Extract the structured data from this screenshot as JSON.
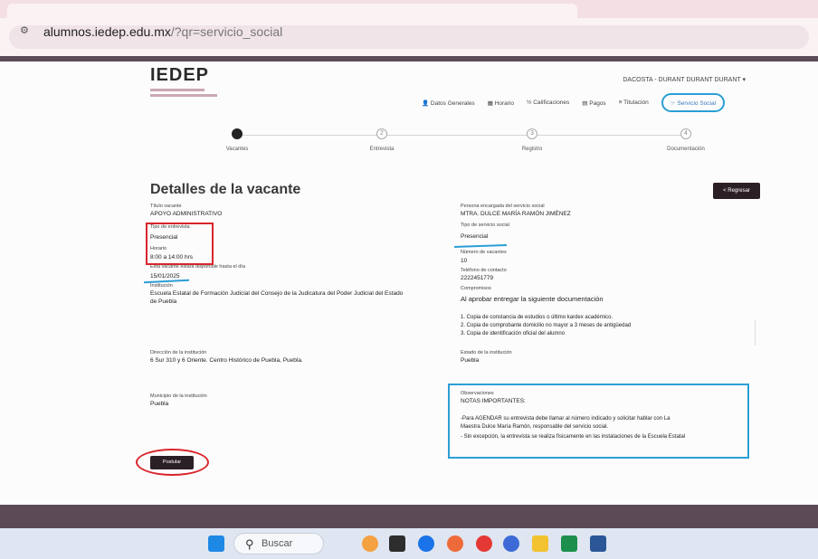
{
  "browser": {
    "url_host": "alumnos.iedep.edu.mx",
    "url_path": "/?qr=servicio_social",
    "site_icon": "tune-icon"
  },
  "header": {
    "logo": "IEDEP",
    "user": "DACOSTA - DURANT DURANT DURANT"
  },
  "nav": [
    {
      "label": "Datos Generales",
      "icon": "person-icon"
    },
    {
      "label": "Horario",
      "icon": "grid-icon"
    },
    {
      "label": "Calificaciones",
      "icon": "grade-icon"
    },
    {
      "label": "Pagos",
      "icon": "card-icon"
    },
    {
      "label": "Titulación",
      "icon": "cap-icon"
    },
    {
      "label": "Servicio Social",
      "icon": "hand-icon"
    }
  ],
  "steps": [
    {
      "label": "Vacantes",
      "num": "1"
    },
    {
      "label": "Entrevista",
      "num": "2"
    },
    {
      "label": "Registro",
      "num": "3"
    },
    {
      "label": "Documentación",
      "num": "4"
    }
  ],
  "title": "Detalles de la vacante",
  "regresar": "< Regresar",
  "left": {
    "puesto_label": "Título vacante",
    "puesto": "APOYO ADMINISTRATIVO",
    "tipo_label": "Tipo de entrevista",
    "tipo": "Presencial",
    "horario_label": "Horario",
    "horario": "8:00 a 14:00 hrs",
    "disp_label": "Esta vacante estará disponible hasta el día",
    "disp": "15/01/2025",
    "inst_label": "Institución",
    "inst": "Escuela Estatal de Formación Judicial del Consejo de la Judicatura del Poder Judicial del Estado",
    "inst2": "de Puebla",
    "dir_label": "Dirección de la institución",
    "dir": "6 Sur 310 y 6 Oriente. Centro Histórico de Puebla, Puebla.",
    "mun_label": "Municipio de la institución",
    "mun": "Puebla"
  },
  "right": {
    "resp_label": "Persona encargada del servicio social",
    "resp": "MTRA. DULCE MARÍA RAMÓN JIMÉNEZ",
    "tipo_label": "Tipo de servicio social",
    "tipo": "Presencial",
    "num_label": "Número de vacantes",
    "num": "10",
    "tel_label": "Teléfono de contacto",
    "tel": "2222451779",
    "req_label": "Compromisos",
    "req": "Al aprobar entregar la siguiente documentación",
    "req1": "1. Copia de constancia de estudios o último kardex académico.",
    "req2": "2. Copia de comprobante domicilio no mayor a 3 meses de antigüedad",
    "req3": "3. Copia de identificación oficial del alumno",
    "edo_label": "Estado de la institución",
    "edo": "Puebla",
    "obs_label": "Observaciones",
    "obs1": "NOTAS IMPORTANTES:",
    "obs2": "-Para AGENDAR su entrevista debe llamar al número indicado y solicitar hablar con La",
    "obs3": "Maestra Dulce María Ramón, responsable del servicio social.",
    "obs4": "- Sin excepción, la entrevista se realiza físicamente en las instalaciones de la Escuela Estatal"
  },
  "postular": "Postular",
  "taskbar": {
    "search": "Buscar"
  }
}
